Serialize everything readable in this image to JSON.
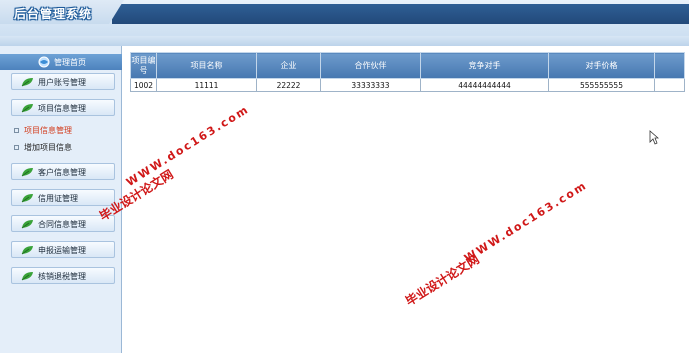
{
  "header": {
    "title": "后台管理系统"
  },
  "sidebar": {
    "home_label": "管理首页",
    "menu": [
      {
        "label": "用户账号管理"
      },
      {
        "label": "项目信息管理"
      }
    ],
    "sub_items": [
      {
        "label": "项目信息管理",
        "active": true
      },
      {
        "label": "增加项目信息",
        "active": false
      }
    ],
    "menu2": [
      {
        "label": "客户信息管理"
      },
      {
        "label": "信用证管理"
      },
      {
        "label": "合同信息管理"
      },
      {
        "label": "申报运输管理"
      },
      {
        "label": "核销退税管理"
      }
    ]
  },
  "table": {
    "headers": [
      "项目编号",
      "项目名称",
      "企业",
      "合作伙伴",
      "竞争对手",
      "对手价格",
      ""
    ],
    "rows": [
      [
        "1002",
        "11111",
        "22222",
        "33333333",
        "44444444444",
        "555555555",
        ""
      ]
    ]
  },
  "watermarks": [
    "毕业设计论文网",
    "WWW.doc163.com"
  ],
  "colors": {
    "accent": "#4677b0",
    "header_dark": "#22497a",
    "watermark": "#d01818"
  }
}
